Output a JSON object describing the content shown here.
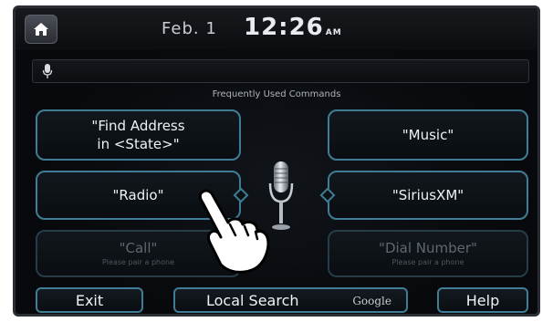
{
  "status_bar": {
    "date": "Feb. 1",
    "time": "12:26",
    "ampm": "AM"
  },
  "section_title": "Frequently Used Commands",
  "commands": {
    "find_address_line1": "\"Find Address",
    "find_address_line2": "in <State>\"",
    "music": "\"Music\"",
    "radio": "\"Radio\"",
    "siriusxm": "\"SiriusXM\"",
    "call": "\"Call\"",
    "call_sub": "Please pair a phone",
    "dial_number": "\"Dial Number\"",
    "dial_sub": "Please pair a phone"
  },
  "bottom": {
    "exit": "Exit",
    "local_search": "Local Search",
    "google": "Google",
    "help": "Help"
  },
  "colors": {
    "accent_border": "#3f7d97",
    "background": "#07090c"
  },
  "icons": [
    "home-icon",
    "microphone-icon",
    "large-microphone-icon",
    "pointing-hand-icon"
  ]
}
